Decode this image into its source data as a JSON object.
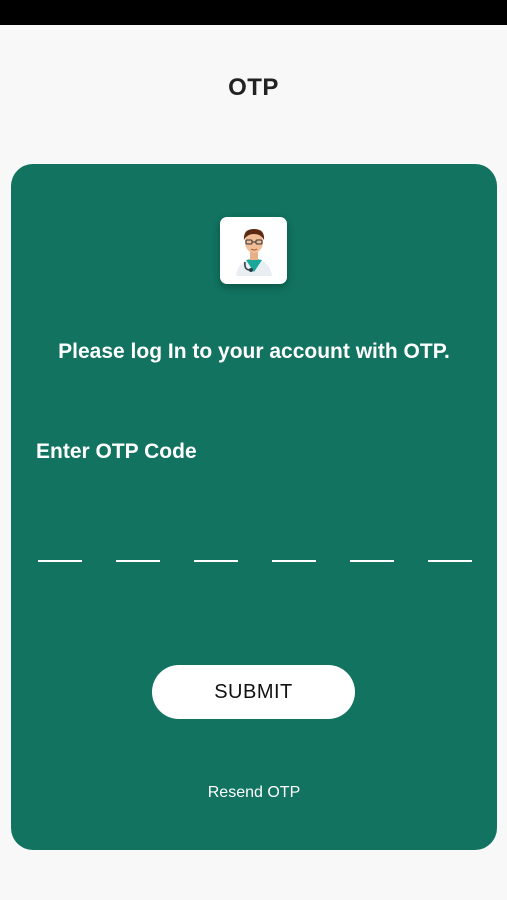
{
  "header": {
    "title": "OTP"
  },
  "card": {
    "message": "Please log In to your account with OTP.",
    "otp_label": "Enter OTP Code",
    "otp_slots": [
      "",
      "",
      "",
      "",
      "",
      ""
    ],
    "submit_label": "SUBMIT",
    "resend_label": "Resend OTP",
    "avatar_icon": "doctor-avatar-icon"
  },
  "colors": {
    "card_background": "#117360",
    "page_background": "#f8f8f8",
    "status_bar": "#000000"
  }
}
